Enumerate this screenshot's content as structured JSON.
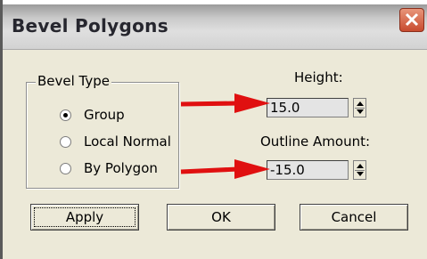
{
  "window": {
    "title": "Bevel Polygons"
  },
  "bevel_type": {
    "label": "Bevel Type",
    "options": [
      {
        "label": "Group",
        "checked": true
      },
      {
        "label": "Local Normal",
        "checked": false
      },
      {
        "label": "By Polygon",
        "checked": false
      }
    ]
  },
  "height": {
    "label": "Height:",
    "value": "15.0"
  },
  "outline": {
    "label": "Outline Amount:",
    "value": "-15.0"
  },
  "buttons": {
    "apply": "Apply",
    "ok": "OK",
    "cancel": "Cancel"
  },
  "colors": {
    "annotation_arrow": "#e01010",
    "dialog_bg": "#ece9d8"
  },
  "icons": {
    "close": "close-icon",
    "spinner_up": "triangle-up",
    "spinner_down": "triangle-down"
  }
}
